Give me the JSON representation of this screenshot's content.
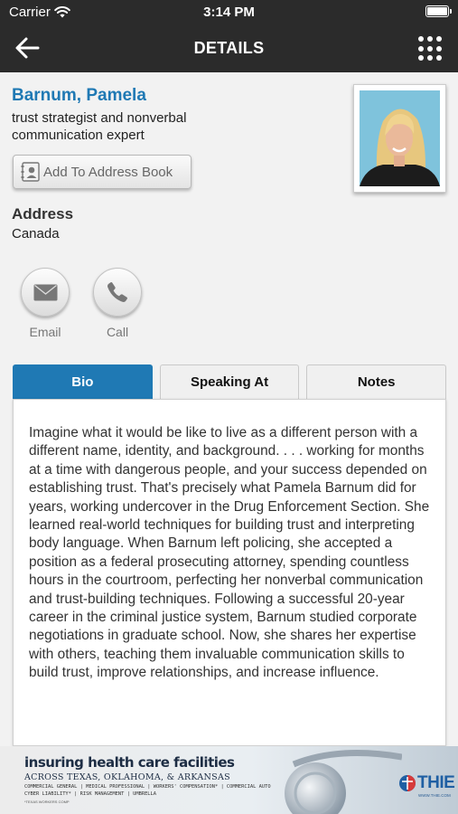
{
  "status_bar": {
    "carrier": "Carrier",
    "time": "3:14 PM",
    "icons": [
      "wifi-icon",
      "battery-icon"
    ]
  },
  "nav": {
    "title": "DETAILS",
    "back_icon": "arrow-left-icon",
    "menu_icon": "grid-menu-icon"
  },
  "profile": {
    "name": "Barnum, Pamela",
    "subtitle": "trust strategist and nonverbal communication expert",
    "add_to_address_book": "Add To Address Book",
    "address_label": "Address",
    "address_value": "Canada"
  },
  "actions": [
    {
      "label": "Email",
      "icon": "envelope-icon"
    },
    {
      "label": "Call",
      "icon": "phone-icon"
    }
  ],
  "tabs": [
    {
      "label": "Bio",
      "active": true
    },
    {
      "label": "Speaking At",
      "active": false
    },
    {
      "label": "Notes",
      "active": false
    }
  ],
  "bio": "Imagine what it would be like to live as a different person with a different name, identity, and background. . . . working for months at a time with dangerous people, and your success depended on establishing trust. That's precisely what Pamela Barnum did for years, working undercover in the Drug Enforcement Section. She learned real-world techniques for building trust and interpreting body language. When Barnum left policing, she accepted a position as a federal prosecuting attorney, spending countless hours in the courtroom, perfecting her nonverbal communication and trust-building techniques. Following a successful 20-year career in the criminal justice system, Barnum studied corporate negotiations in graduate school. Now, she shares her expertise with others, teaching them invaluable communication skills to build trust, improve relationships, and increase influence.",
  "banner": {
    "line1": "insuring health care facilities",
    "line2": "ACROSS TEXAS, OKLAHOMA, & ARKANSAS",
    "line3": "COMMERCIAL GENERAL | MEDICAL PROFESSIONAL | WORKERS' COMPENSATION* | COMMERCIAL AUTO",
    "line4": "CYBER LIABILITY* | RISK MANAGEMENT | UMBRELLA",
    "line5": "*TEXAS WORKERS COMP",
    "logo": "THIE",
    "url": "WWW.THIE.COM"
  },
  "colors": {
    "accent": "#1f79b4",
    "nav_bg": "#2b2b2b",
    "page_bg": "#f2f2f2"
  }
}
